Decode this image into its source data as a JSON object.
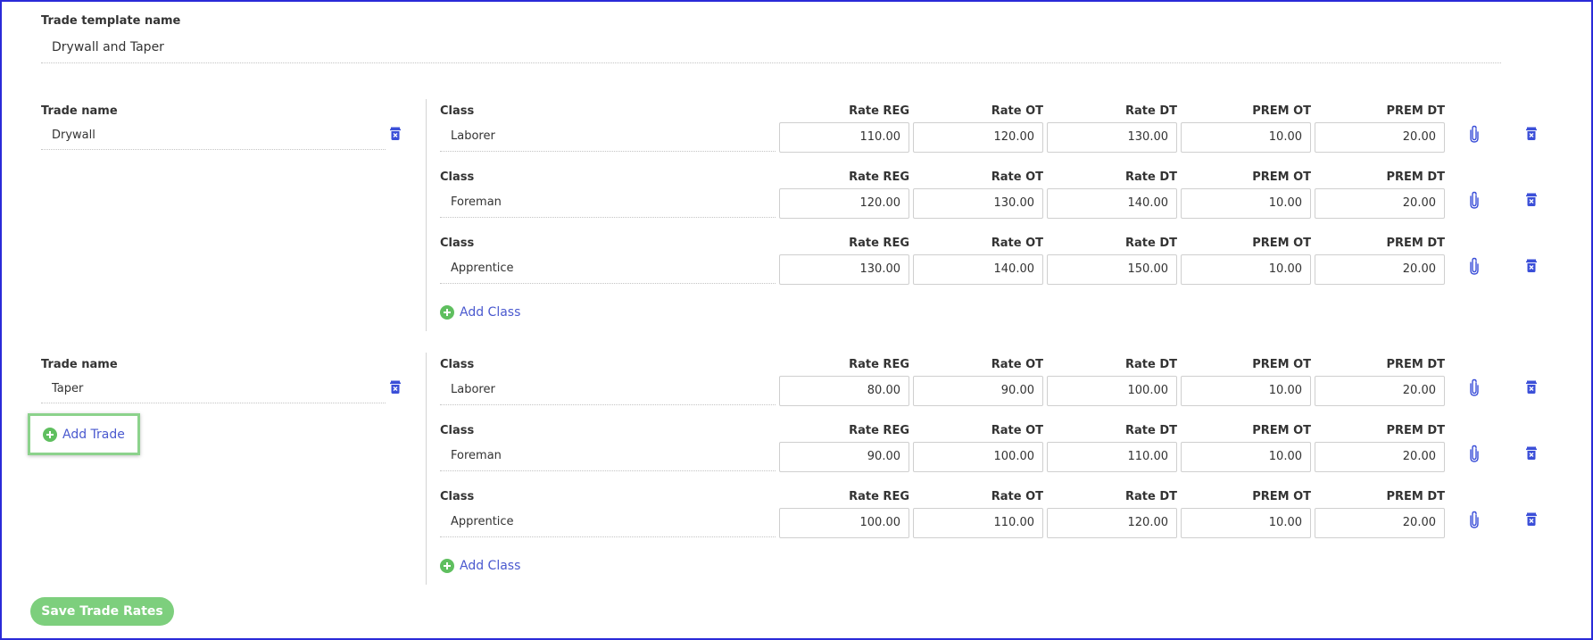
{
  "template": {
    "label": "Trade template name",
    "value": "Drywall and Taper"
  },
  "labels": {
    "trade_name": "Trade name",
    "class": "Class",
    "rate_reg": "Rate REG",
    "rate_ot": "Rate OT",
    "rate_dt": "Rate DT",
    "prem_ot": "PREM OT",
    "prem_dt": "PREM DT",
    "add_class": "Add Class",
    "add_trade": "Add Trade",
    "save": "Save Trade Rates"
  },
  "trades": [
    {
      "name": "Drywall",
      "classes": [
        {
          "name": "Laborer",
          "rate_reg": "110.00",
          "rate_ot": "120.00",
          "rate_dt": "130.00",
          "prem_ot": "10.00",
          "prem_dt": "20.00"
        },
        {
          "name": "Foreman",
          "rate_reg": "120.00",
          "rate_ot": "130.00",
          "rate_dt": "140.00",
          "prem_ot": "10.00",
          "prem_dt": "20.00"
        },
        {
          "name": "Apprentice",
          "rate_reg": "130.00",
          "rate_ot": "140.00",
          "rate_dt": "150.00",
          "prem_ot": "10.00",
          "prem_dt": "20.00"
        }
      ]
    },
    {
      "name": "Taper",
      "classes": [
        {
          "name": "Laborer",
          "rate_reg": "80.00",
          "rate_ot": "90.00",
          "rate_dt": "100.00",
          "prem_ot": "10.00",
          "prem_dt": "20.00"
        },
        {
          "name": "Foreman",
          "rate_reg": "90.00",
          "rate_ot": "100.00",
          "rate_dt": "110.00",
          "prem_ot": "10.00",
          "prem_dt": "20.00"
        },
        {
          "name": "Apprentice",
          "rate_reg": "100.00",
          "rate_ot": "110.00",
          "rate_dt": "120.00",
          "prem_ot": "10.00",
          "prem_dt": "20.00"
        }
      ]
    }
  ],
  "colors": {
    "link": "#4a59cf",
    "accent_green": "#7dcf7d",
    "icon_blue": "#3b4fd8",
    "frame_border": "#2a2ad8"
  },
  "icons": {
    "trash": "trash-icon",
    "attachment": "paperclip-icon",
    "add": "plus-circle-icon"
  }
}
